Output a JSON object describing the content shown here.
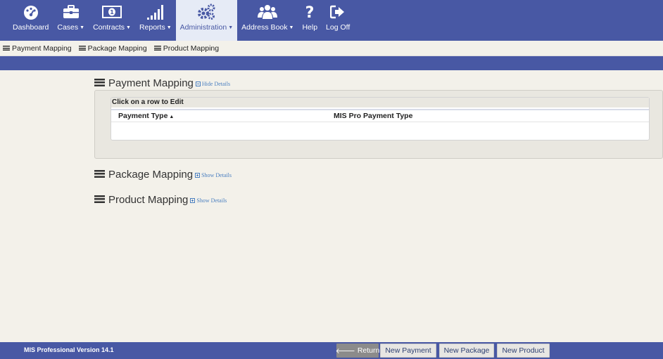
{
  "nav": {
    "items": [
      {
        "label": "Dashboard",
        "icon": "dashboard-gauge-icon",
        "caret": false
      },
      {
        "label": "Cases",
        "icon": "briefcase-icon",
        "caret": true
      },
      {
        "label": "Contracts",
        "icon": "money-icon",
        "caret": true
      },
      {
        "label": "Reports",
        "icon": "bar-chart-icon",
        "caret": true
      },
      {
        "label": "Administration",
        "icon": "gears-icon",
        "caret": true,
        "active": true
      },
      {
        "label": "Address Book",
        "icon": "users-icon",
        "caret": true
      },
      {
        "label": "Help",
        "icon": "question-icon",
        "caret": false
      },
      {
        "label": "Log Off",
        "icon": "sign-out-icon",
        "caret": false
      }
    ]
  },
  "subnav": {
    "items": [
      "Payment Mapping",
      "Package Mapping",
      "Product Mapping"
    ]
  },
  "sections": {
    "payment": {
      "title": "Payment Mapping",
      "toggle": "Hide Details"
    },
    "package": {
      "title": "Package Mapping",
      "toggle": "Show Details"
    },
    "product": {
      "title": "Product Mapping",
      "toggle": "Show Details"
    }
  },
  "grid": {
    "caption": "Click on a row to Edit",
    "columns": [
      "Payment Type",
      "MIS Pro Payment Type"
    ]
  },
  "footer": {
    "version": "MIS Professional Version 14.1",
    "return_label": "Return",
    "new_payment": "New Payment",
    "new_package": "New Package",
    "new_product": "New Product"
  },
  "colors": {
    "brand": "#4858a4",
    "link": "#4a7fc0",
    "background": "#f3f1ea"
  }
}
